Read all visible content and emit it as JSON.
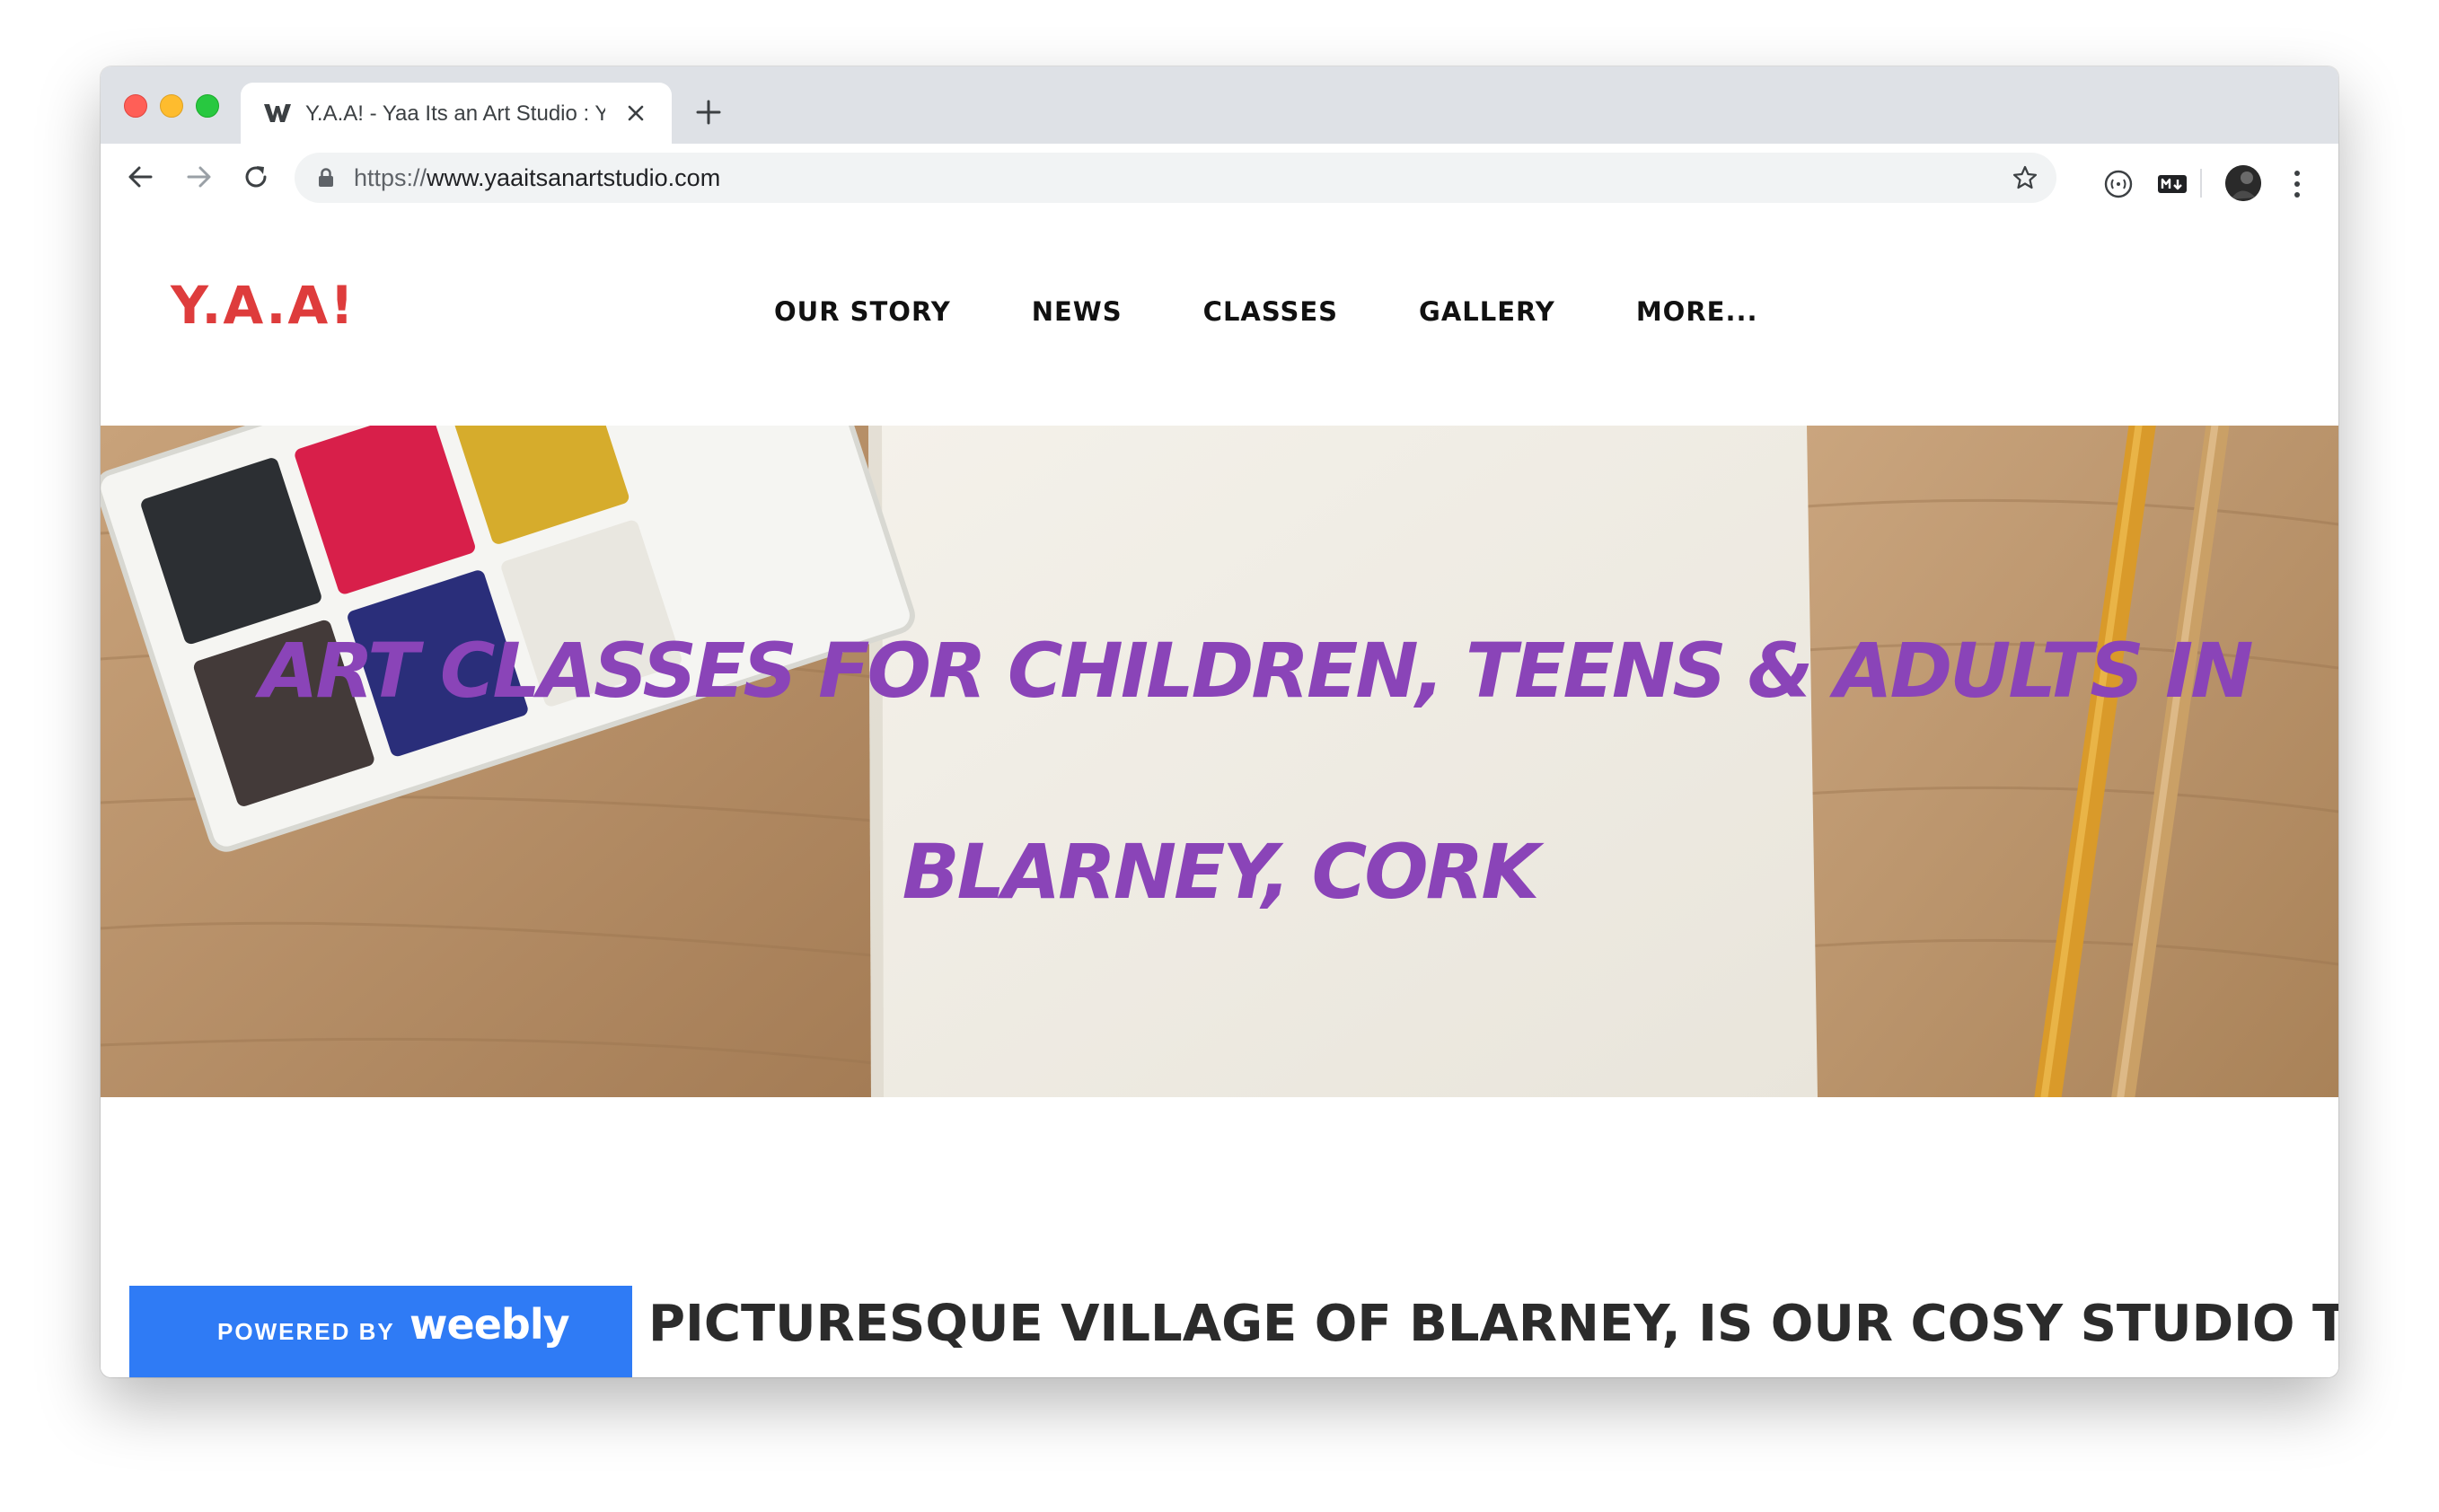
{
  "browser": {
    "tab": {
      "title": "Y.A.A! - Yaa Its an Art Studio : Yaa Its an Art Studio",
      "favicon": "weebly-w-icon"
    },
    "url_scheme": "https://",
    "url_host": "www.yaaitsanartstudio.com",
    "extensions": [
      "colorzilla-icon",
      "markdown-icon"
    ],
    "colors": {
      "tabstrip": "#dee1e6",
      "omnibox": "#f1f3f4"
    }
  },
  "site": {
    "logo": "Y.A.A!",
    "nav": [
      "OUR STORY",
      "NEWS",
      "CLASSES",
      "GALLERY",
      "MORE..."
    ],
    "hero": {
      "line1": "ART CLASSES FOR CHILDREN, TEENS & ADULTS IN",
      "line2": "BLARNEY, CORK"
    },
    "intro_text": "PICTURESQUE VILLAGE OF BLARNEY, IS OUR COSY STUDIO THAT",
    "colors": {
      "logo": "#de3c3c",
      "hero_text": "#8a44b8",
      "badge": "#2f7bf5"
    }
  },
  "badge": {
    "powered": "POWERED BY",
    "brand": "weebly"
  }
}
